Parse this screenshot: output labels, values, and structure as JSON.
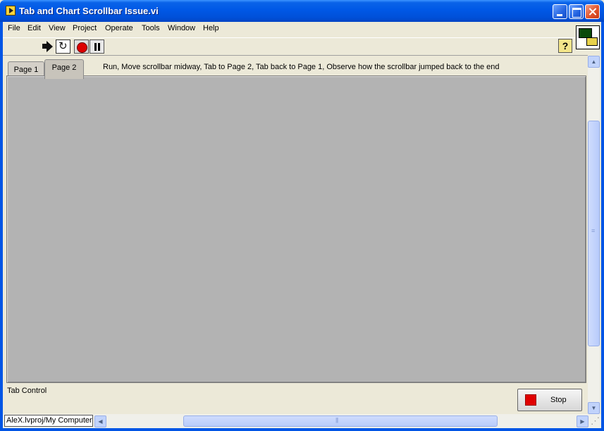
{
  "window": {
    "title": "Tab and Chart Scrollbar Issue.vi"
  },
  "menu": [
    "File",
    "Edit",
    "View",
    "Project",
    "Operate",
    "Tools",
    "Window",
    "Help"
  ],
  "toolbar": {
    "run_icon": "run-arrow-icon",
    "run_continuously_icon": "run-continuously-icon",
    "abort_icon": "abort-icon",
    "pause_icon": "pause-icon",
    "help_label": "?"
  },
  "panel": {
    "tabs": [
      {
        "label": "Page 1",
        "selected": false
      },
      {
        "label": "Page 2",
        "selected": true
      }
    ],
    "instructions": "Run, Move scrollbar midway, Tab to Page 2, Tab back to Page 1, Observe how the scrollbar jumped back to the end",
    "tab_control_label": "Tab Control",
    "stop_button_label": "Stop"
  },
  "status": {
    "context": "AleX.lvproj/My Computer"
  },
  "colors": {
    "titlebar": "#0058e6",
    "tab_body": "#b3b3b3",
    "stop_led": "#e00000"
  }
}
